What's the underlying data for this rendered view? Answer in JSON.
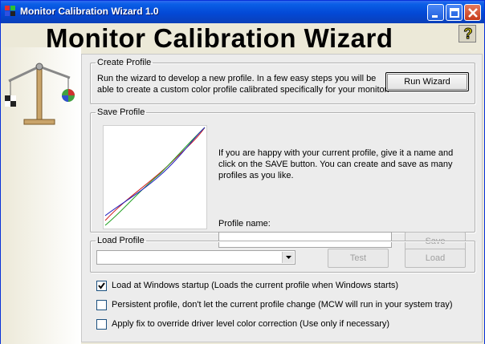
{
  "window": {
    "title": "Monitor Calibration Wizard 1.0",
    "controls": {
      "minimize": "minimize",
      "maximize": "maximize",
      "close": "close"
    }
  },
  "header": {
    "title": "Monitor Calibration Wizard",
    "help": "?"
  },
  "create_profile": {
    "legend": "Create Profile",
    "line1": "Run the wizard to develop a new profile.  In a few easy steps you will be",
    "line2": "able to create a custom color profile calibrated specifically for your monitor.",
    "run_button": "Run Wizard"
  },
  "save_profile": {
    "legend": "Save Profile",
    "line1": "If you are happy with your current profile, give it a name and",
    "line2": "click on the SAVE button.  You can create and save as many",
    "line3": "profiles as you like.",
    "name_label": "Profile name:",
    "name_value": "",
    "save_button": "Save"
  },
  "load_profile": {
    "legend": "Load Profile",
    "selected": "",
    "test_button": "Test",
    "load_button": "Load"
  },
  "options": [
    {
      "label": "Load at Windows startup (Loads the current profile when Windows starts)",
      "checked": true
    },
    {
      "label": "Persistent profile, don't let the current profile change (MCW will run in your system tray)",
      "checked": false
    },
    {
      "label": "Apply fix to override driver level color correction (Use only if necessary)",
      "checked": false
    }
  ],
  "colors": {
    "titlebar": "#0a5ee6",
    "close": "#c63a1a",
    "curve_red": "#d02020",
    "curve_green": "#20a020",
    "curve_blue": "#2020c0"
  }
}
